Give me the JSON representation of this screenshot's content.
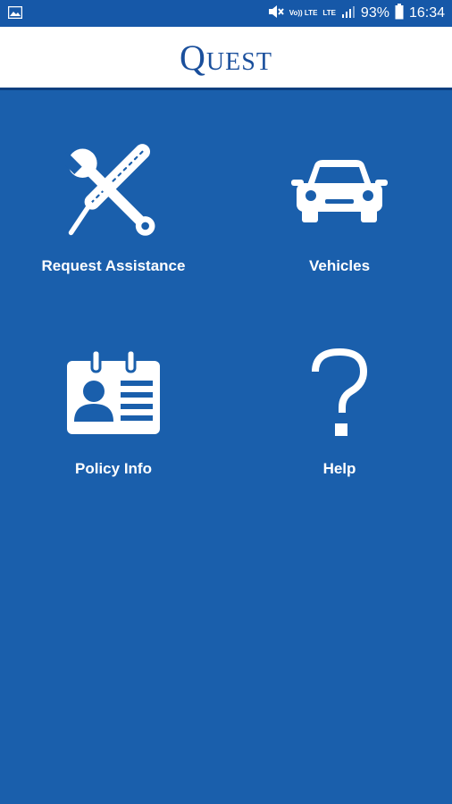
{
  "status_bar": {
    "battery": "93%",
    "time": "16:34",
    "volte_label": "Vo)) LTE",
    "lte_label": "LTE"
  },
  "header": {
    "brand": "Quest"
  },
  "tiles": [
    {
      "label": "Request Assistance",
      "icon": "tools-icon"
    },
    {
      "label": "Vehicles",
      "icon": "car-icon"
    },
    {
      "label": "Policy Info",
      "icon": "id-card-icon"
    },
    {
      "label": "Help",
      "icon": "help-icon"
    }
  ],
  "colors": {
    "background": "#1a5fac",
    "header_bg": "#ffffff",
    "brand": "#1a4f9c"
  }
}
